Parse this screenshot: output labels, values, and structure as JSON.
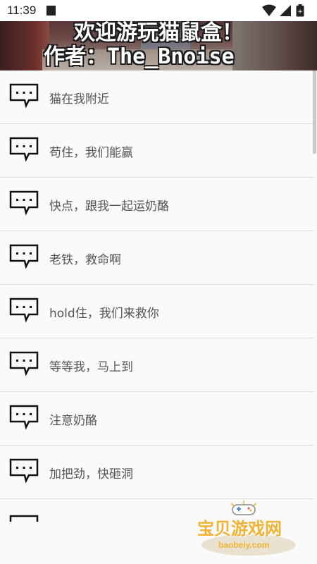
{
  "status_bar": {
    "time": "11:39",
    "icons": [
      "wifi-icon",
      "signal-icon",
      "battery-icon"
    ]
  },
  "banner": {
    "title": "欢迎游玩猫鼠盒！",
    "author": "作者：The_Bnoise"
  },
  "list": {
    "items": [
      {
        "label": "猫在我附近",
        "icon": "message-bubble-icon"
      },
      {
        "label": "苟住，我们能赢",
        "icon": "message-bubble-icon"
      },
      {
        "label": "快点，跟我一起运奶酪",
        "icon": "message-bubble-icon"
      },
      {
        "label": "老铁，救命啊",
        "icon": "message-bubble-icon"
      },
      {
        "label": "hold住，我们来救你",
        "icon": "message-bubble-icon"
      },
      {
        "label": "等等我，马上到",
        "icon": "message-bubble-icon"
      },
      {
        "label": "注意奶酪",
        "icon": "message-bubble-icon"
      },
      {
        "label": "加把劲，快砸洞",
        "icon": "message-bubble-icon"
      }
    ]
  },
  "watermark": {
    "text": "宝贝游戏网",
    "url": "baobeiy.com",
    "icon": "gamepad-icon"
  },
  "colors": {
    "status_bar_bg": "#ffffff",
    "list_bg": "#fafafa",
    "divider": "#d9d9d9",
    "label_text": "#555555",
    "watermark_gold": "#f2b233"
  }
}
